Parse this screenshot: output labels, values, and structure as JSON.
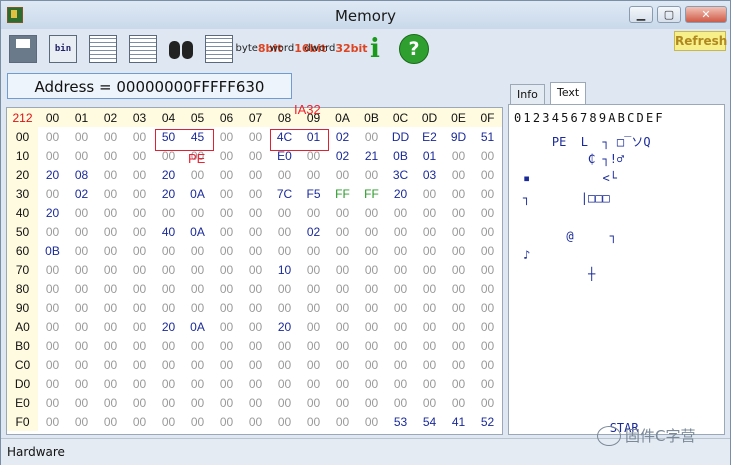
{
  "window": {
    "title": "Memory"
  },
  "toolbar": {
    "bit_buttons": [
      {
        "top": "byte",
        "bottom": "8bit",
        "color": "#d42"
      },
      {
        "top": "word",
        "bottom": "16bit",
        "color": "#d42"
      },
      {
        "top": "dword",
        "bottom": "32bit",
        "color": "#d42"
      }
    ],
    "refresh_label": "Refresh",
    "bin_label": "bin",
    "info_label": "i",
    "help_label": "?"
  },
  "address": {
    "text": "Address = 00000000FFFFF630"
  },
  "hex": {
    "corner": "212",
    "columns": [
      "00",
      "01",
      "02",
      "03",
      "04",
      "05",
      "06",
      "07",
      "08",
      "09",
      "0A",
      "0B",
      "0C",
      "0D",
      "0E",
      "0F"
    ],
    "rows": [
      {
        "label": "00",
        "cells": [
          "00",
          "00",
          "00",
          "00",
          "50",
          "45",
          "00",
          "00",
          "4C",
          "01",
          "02",
          "00",
          "DD",
          "E2",
          "9D",
          "51"
        ]
      },
      {
        "label": "10",
        "cells": [
          "00",
          "00",
          "00",
          "00",
          "00",
          "00",
          "00",
          "00",
          "E0",
          "00",
          "02",
          "21",
          "0B",
          "01",
          "00",
          "00"
        ]
      },
      {
        "label": "20",
        "cells": [
          "20",
          "08",
          "00",
          "00",
          "20",
          "00",
          "00",
          "00",
          "00",
          "00",
          "00",
          "00",
          "3C",
          "03",
          "00",
          "00"
        ]
      },
      {
        "label": "30",
        "cells": [
          "00",
          "02",
          "00",
          "00",
          "20",
          "0A",
          "00",
          "00",
          "7C",
          "F5",
          "FF",
          "FF",
          "20",
          "00",
          "00",
          "00"
        ]
      },
      {
        "label": "40",
        "cells": [
          "20",
          "00",
          "00",
          "00",
          "00",
          "00",
          "00",
          "00",
          "00",
          "00",
          "00",
          "00",
          "00",
          "00",
          "00",
          "00"
        ]
      },
      {
        "label": "50",
        "cells": [
          "00",
          "00",
          "00",
          "00",
          "40",
          "0A",
          "00",
          "00",
          "00",
          "02",
          "00",
          "00",
          "00",
          "00",
          "00",
          "00"
        ]
      },
      {
        "label": "60",
        "cells": [
          "0B",
          "00",
          "00",
          "00",
          "00",
          "00",
          "00",
          "00",
          "00",
          "00",
          "00",
          "00",
          "00",
          "00",
          "00",
          "00"
        ]
      },
      {
        "label": "70",
        "cells": [
          "00",
          "00",
          "00",
          "00",
          "00",
          "00",
          "00",
          "00",
          "10",
          "00",
          "00",
          "00",
          "00",
          "00",
          "00",
          "00"
        ]
      },
      {
        "label": "80",
        "cells": [
          "00",
          "00",
          "00",
          "00",
          "00",
          "00",
          "00",
          "00",
          "00",
          "00",
          "00",
          "00",
          "00",
          "00",
          "00",
          "00"
        ]
      },
      {
        "label": "90",
        "cells": [
          "00",
          "00",
          "00",
          "00",
          "00",
          "00",
          "00",
          "00",
          "00",
          "00",
          "00",
          "00",
          "00",
          "00",
          "00",
          "00"
        ]
      },
      {
        "label": "A0",
        "cells": [
          "00",
          "00",
          "00",
          "00",
          "20",
          "0A",
          "00",
          "00",
          "20",
          "00",
          "00",
          "00",
          "00",
          "00",
          "00",
          "00"
        ]
      },
      {
        "label": "B0",
        "cells": [
          "00",
          "00",
          "00",
          "00",
          "00",
          "00",
          "00",
          "00",
          "00",
          "00",
          "00",
          "00",
          "00",
          "00",
          "00",
          "00"
        ]
      },
      {
        "label": "C0",
        "cells": [
          "00",
          "00",
          "00",
          "00",
          "00",
          "00",
          "00",
          "00",
          "00",
          "00",
          "00",
          "00",
          "00",
          "00",
          "00",
          "00"
        ]
      },
      {
        "label": "D0",
        "cells": [
          "00",
          "00",
          "00",
          "00",
          "00",
          "00",
          "00",
          "00",
          "00",
          "00",
          "00",
          "00",
          "00",
          "00",
          "00",
          "00"
        ]
      },
      {
        "label": "E0",
        "cells": [
          "00",
          "00",
          "00",
          "00",
          "00",
          "00",
          "00",
          "00",
          "00",
          "00",
          "00",
          "00",
          "00",
          "00",
          "00",
          "00"
        ]
      },
      {
        "label": "F0",
        "cells": [
          "00",
          "00",
          "00",
          "00",
          "00",
          "00",
          "00",
          "00",
          "00",
          "00",
          "00",
          "00",
          "53",
          "54",
          "41",
          "52"
        ]
      }
    ],
    "annotations": {
      "pe": "PE",
      "ia32": "IA32"
    }
  },
  "right_panel": {
    "tabs": [
      "Info",
      "Text"
    ],
    "active_tab": "Text",
    "header": "0123456789ABCDEF",
    "rows": [
      "    PE  L  ┐ □‾ソQ",
      "         ₵ ┐!♂",
      "▪          <└",
      "┐       |□□□",
      "",
      "      @     ┐",
      "♪",
      "         ┼",
      "",
      "",
      "",
      "",
      "",
      "",
      "",
      "            STAR"
    ]
  },
  "status": {
    "text": "Hardware"
  },
  "watermark": {
    "text": "固件C字营"
  }
}
